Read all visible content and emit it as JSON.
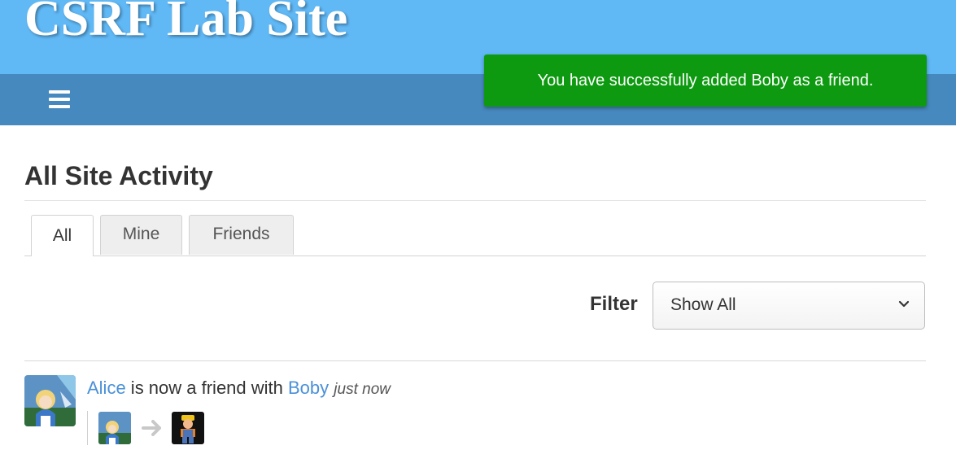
{
  "header": {
    "site_title": "CSRF Lab Site"
  },
  "toast": {
    "message": "You have successfully added Boby as a friend."
  },
  "page": {
    "heading": "All Site Activity"
  },
  "tabs": [
    {
      "label": "All",
      "active": true
    },
    {
      "label": "Mine",
      "active": false
    },
    {
      "label": "Friends",
      "active": false
    }
  ],
  "filter": {
    "label": "Filter",
    "selected": "Show All"
  },
  "activity": {
    "actor": "Alice",
    "verb": " is now a friend with ",
    "target": "Boby",
    "time": "just now"
  },
  "colors": {
    "header_bg": "#60b8f5",
    "navbar_bg": "#4689be",
    "toast_bg": "#0e9a10",
    "link": "#4a90d9"
  },
  "icons": [
    "menu-icon",
    "chevron-down-icon",
    "arrow-right-icon"
  ]
}
